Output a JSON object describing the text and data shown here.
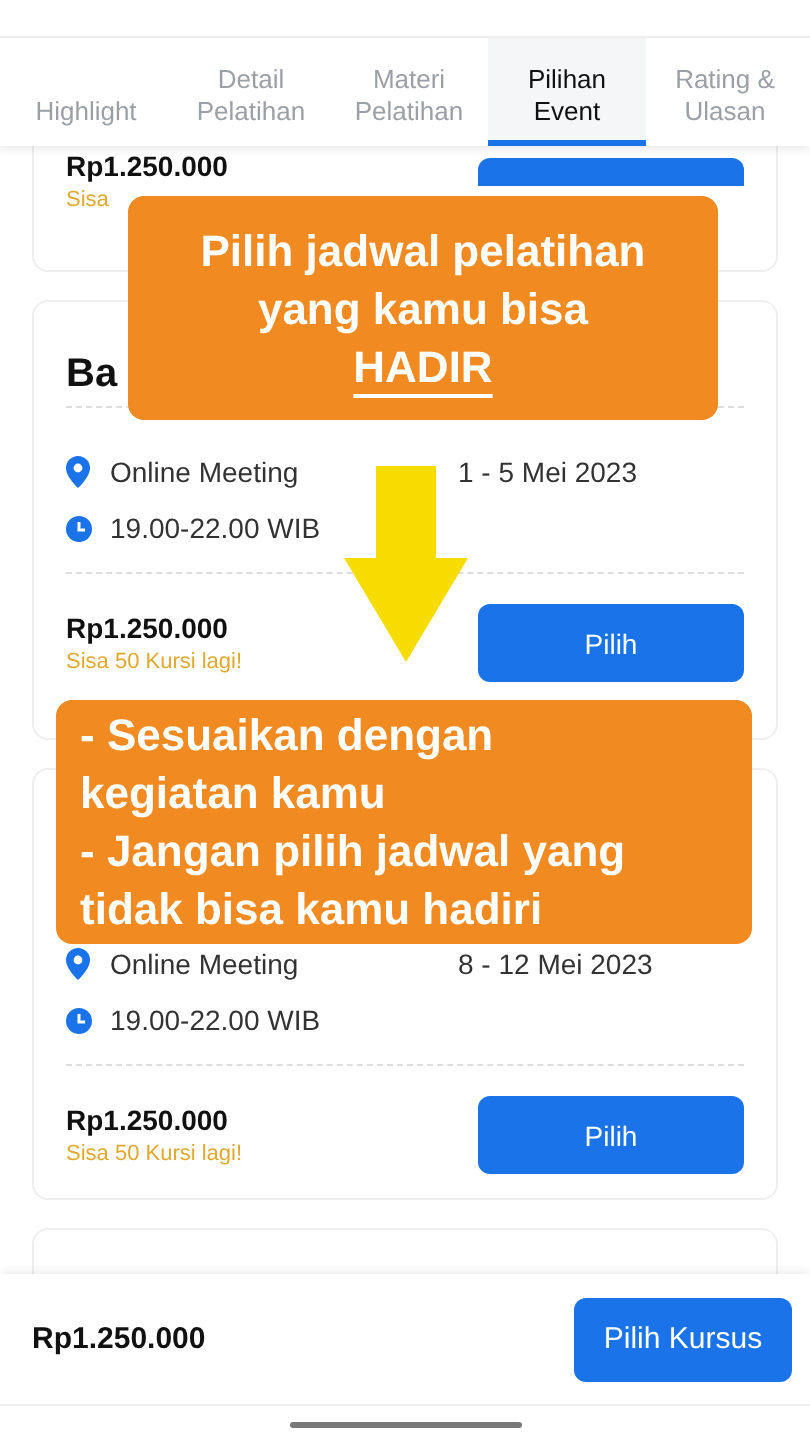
{
  "tabs": [
    {
      "label": "Highlight",
      "selected": false
    },
    {
      "label": "Detail Pelatihan",
      "selected": false
    },
    {
      "label": "Materi Pelatihan",
      "selected": false
    },
    {
      "label": "Pilihan Event",
      "selected": true
    },
    {
      "label": "Rating & Ulasan",
      "selected": false
    }
  ],
  "events": [
    {
      "price": "Rp1.250.000",
      "seats": "Sisa"
    },
    {
      "title": "Ba",
      "location": "Online Meeting",
      "date": "1 - 5 Mei 2023",
      "time": "19.00-22.00 WIB",
      "price": "Rp1.250.000",
      "seats": "Sisa 50 Kursi lagi!",
      "button": "Pilih"
    },
    {
      "location": "Online Meeting",
      "date": "8 - 12 Mei 2023",
      "time": "19.00-22.00 WIB",
      "price": "Rp1.250.000",
      "seats": "Sisa 50 Kursi lagi!",
      "button": "Pilih"
    }
  ],
  "callouts": [
    {
      "lines": [
        {
          "text": "Pilih jadwal pelatihan",
          "underlined": false
        },
        {
          "text": "yang kamu bisa",
          "underlined": false
        },
        {
          "text": "HADIR",
          "underlined": true
        }
      ]
    },
    {
      "lines": [
        {
          "text": "- Sesuaikan dengan",
          "underlined": false
        },
        {
          "text": "kegiatan kamu",
          "underlined": false
        },
        {
          "text": "- Jangan pilih jadwal yang",
          "underlined": false
        },
        {
          "text": "tidak bisa kamu hadiri",
          "underlined": false
        }
      ]
    }
  ],
  "bottom_bar": {
    "price": "Rp1.250.000",
    "button": "Pilih Kursus"
  }
}
